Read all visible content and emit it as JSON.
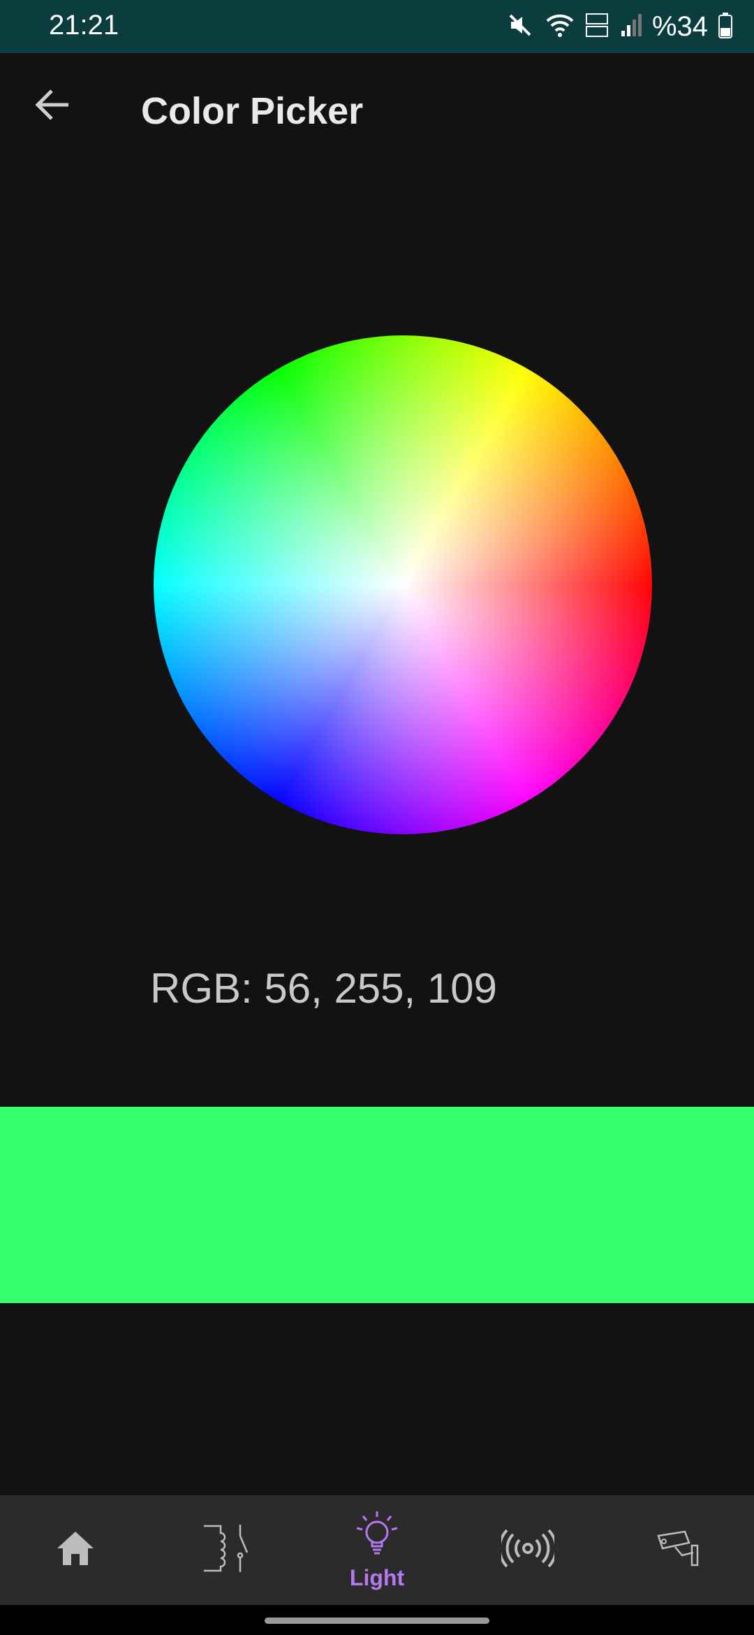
{
  "status_bar": {
    "time": "21:21",
    "battery": "%34",
    "icons": [
      "mute-icon",
      "wifi-icon",
      "volte-icon",
      "signal-icon",
      "battery-icon"
    ]
  },
  "app_bar": {
    "title": "Color Picker",
    "back_icon": "back-arrow-icon"
  },
  "picker": {
    "rgb_text": "RGB: 56, 255, 109",
    "selected_color": "#38ff6d"
  },
  "bottom_nav": {
    "items": [
      {
        "icon": "home-icon",
        "label": ""
      },
      {
        "icon": "relay-switch-icon",
        "label": ""
      },
      {
        "icon": "lightbulb-icon",
        "label": "Light",
        "active": true
      },
      {
        "icon": "broadcast-icon",
        "label": ""
      },
      {
        "icon": "security-camera-icon",
        "label": ""
      }
    ],
    "active_color": "#b678f0",
    "inactive_color": "#bdbdbd"
  }
}
